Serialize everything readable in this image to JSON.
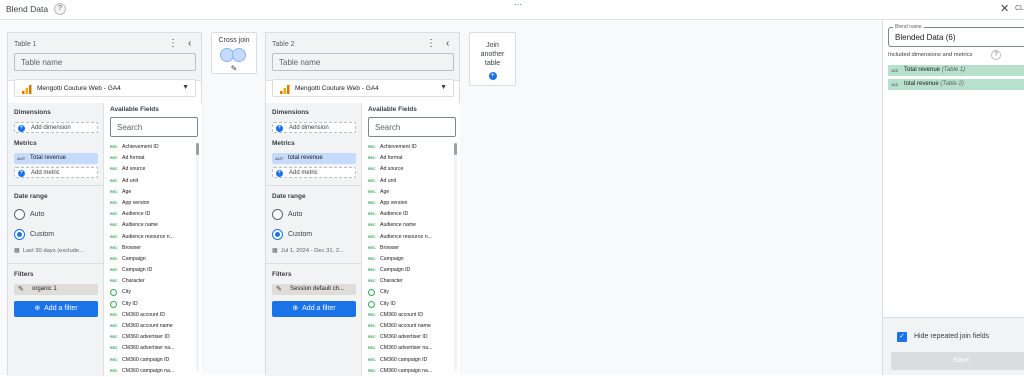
{
  "window": {
    "title": "Blend Data",
    "help": "?",
    "close_label": "CL"
  },
  "tables": [
    {
      "label": "Table 1",
      "name_placeholder": "Table name",
      "source": "Mengotti Couture Web - GA4",
      "dimensions_header": "Dimensions",
      "add_dimension": "Add dimension",
      "metrics_header": "Metrics",
      "metric_agg": "AUT",
      "metric": "Total revenue",
      "add_metric": "Add metric",
      "date_range_header": "Date range",
      "auto_label": "Auto",
      "custom_label": "Custom",
      "selected_range": "Custom",
      "date_text": "Last 30 days (exclude...",
      "filters_header": "Filters",
      "filter_chip": "organic 1",
      "add_filter": "Add a filter",
      "available_header": "Available Fields",
      "search_placeholder": "Search"
    },
    {
      "label": "Table 2",
      "name_placeholder": "Table name",
      "source": "Mengotti Couture Web - GA4",
      "dimensions_header": "Dimensions",
      "add_dimension": "Add dimension",
      "metrics_header": "Metrics",
      "metric_agg": "AUT",
      "metric": "total revenue",
      "add_metric": "Add metric",
      "date_range_header": "Date range",
      "auto_label": "Auto",
      "custom_label": "Custom",
      "selected_range": "Custom",
      "date_text": "Jul 1, 2024 - Dec 31, 2...",
      "filters_header": "Filters",
      "filter_chip": "Session default ch...",
      "add_filter": "Add a filter",
      "available_header": "Available Fields",
      "search_placeholder": "Search"
    }
  ],
  "available_fields": [
    {
      "type": "REC",
      "name": "Achievement ID"
    },
    {
      "type": "REC",
      "name": "Ad format"
    },
    {
      "type": "REC",
      "name": "Ad source"
    },
    {
      "type": "REC",
      "name": "Ad unit"
    },
    {
      "type": "REC",
      "name": "Age"
    },
    {
      "type": "REC",
      "name": "App version"
    },
    {
      "type": "REC",
      "name": "Audience ID"
    },
    {
      "type": "REC",
      "name": "Audience name"
    },
    {
      "type": "REC",
      "name": "Audience resource n..."
    },
    {
      "type": "REC",
      "name": "Browser"
    },
    {
      "type": "REC",
      "name": "Campaign"
    },
    {
      "type": "REC",
      "name": "Campaign ID"
    },
    {
      "type": "REC",
      "name": "Character"
    },
    {
      "type": "GEO",
      "name": "City"
    },
    {
      "type": "GEO",
      "name": "City ID"
    },
    {
      "type": "REC",
      "name": "CM360 account ID"
    },
    {
      "type": "REC",
      "name": "CM360 account name"
    },
    {
      "type": "REC",
      "name": "CM360 advertiser ID"
    },
    {
      "type": "REC",
      "name": "CM360 advertiser na..."
    },
    {
      "type": "REC",
      "name": "CM360 campaign ID"
    },
    {
      "type": "REC",
      "name": "CM360 campaign na..."
    }
  ],
  "cross_join": {
    "label": "Cross join"
  },
  "join_another": {
    "label_lines": [
      "Join",
      "another",
      "table"
    ]
  },
  "sidebar": {
    "blend_name_label": "Blend name",
    "blend_name": "Blended Data (6)",
    "included_header": "Included dimensions and metrics",
    "included": [
      {
        "agg": "123",
        "name": "Total revenue",
        "table": "(Table 1)"
      },
      {
        "agg": "123",
        "name": "total revenue",
        "table": "(Table 2)"
      }
    ],
    "hide_repeated_label": "Hide repeated join fields",
    "hide_repeated_checked": true,
    "save_label": "Save"
  },
  "colors": {
    "accent": "#1a73e8",
    "metric_chip": "#c6dafc",
    "included_chip": "#b7e1cd"
  }
}
